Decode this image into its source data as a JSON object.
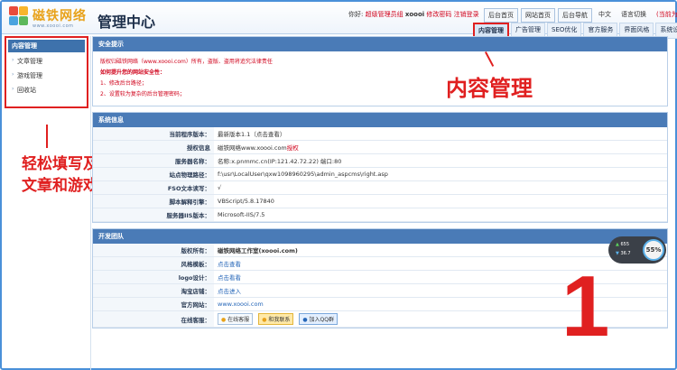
{
  "header": {
    "logo_text": "磁铁网络",
    "logo_url": "www.xoooi.com",
    "title": "管理中心",
    "user_prefix": "你好:",
    "user_role": "超级管理员组",
    "username": "xoooi",
    "change_password": "修改密码",
    "logout": "注销登录",
    "links": [
      "后台首页",
      "网站首页",
      "后台导航"
    ],
    "language": "中文",
    "language_switch": "语言切换",
    "language_note": "(当前为中文)"
  },
  "nav_tabs": [
    "内容管理",
    "广告管理",
    "SEO优化",
    "官方服务",
    "界面风格",
    "系统设置"
  ],
  "sidebar": {
    "title": "内容管理",
    "items": [
      "文章管理",
      "游戏管理",
      "回收站"
    ]
  },
  "annotations": {
    "content_mgmt": "内容管理",
    "sidebar_note_line1": "轻松填写及管理",
    "sidebar_note_line2": "文章和游戏",
    "big_number": "1"
  },
  "security": {
    "title": "安全提示",
    "line1": "版权归磁铁网络（www.xoooi.com）所有，盗版、盗用将追究法律责任",
    "line2": "如何提升您的网站安全性：",
    "line3": "1、修改后台路径；",
    "line4": "2、设置较为复杂的后台管理密码；"
  },
  "system": {
    "title": "系统信息",
    "rows": [
      {
        "label": "当前程序版本：",
        "value": "最新版本1.1（点击查看）"
      },
      {
        "label": "授权信息",
        "value": "磁铁网络www.xoooi.com授权"
      },
      {
        "label": "服务器名称：",
        "value": "名称:x.pnmmc.cn(IP:121.42.72.22) 端口:80"
      },
      {
        "label": "站点物理路径：",
        "value": "f:\\usr\\LocalUser\\qxw1098960295\\admin_aspcms\\right.asp"
      },
      {
        "label": "FSO文本读写：",
        "value": "√"
      },
      {
        "label": "脚本解释引擎：",
        "value": "VBScript/5.8.17840"
      },
      {
        "label": "服务器IIS版本：",
        "value": "Microsoft-IIS/7.5"
      }
    ]
  },
  "team": {
    "title": "开发团队",
    "rows": [
      {
        "label": "版权所有：",
        "value": "磁铁网络工作室(xoooi.com)"
      },
      {
        "label": "风格模板：",
        "value": "点击查看"
      },
      {
        "label": "logo设计：",
        "value": "点击看看"
      },
      {
        "label": "淘宝店铺：",
        "value": "点击进入"
      },
      {
        "label": "官方网站：",
        "value": "www.xoooi.com"
      },
      {
        "label": "在线客服：",
        "value": ""
      }
    ],
    "badges": [
      "在线客服",
      "和我联系",
      "加入QQ群"
    ]
  },
  "speed_widget": {
    "up": "655",
    "down": "36.7",
    "percent": "55%"
  },
  "colors": {
    "accent": "#4a7bb7",
    "annotation": "#e02020",
    "frame": "#4a90d9"
  }
}
